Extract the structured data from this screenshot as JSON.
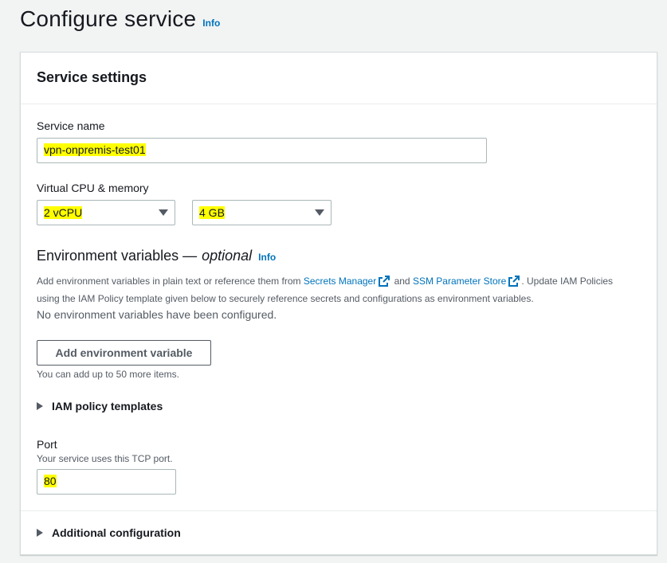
{
  "page": {
    "title": "Configure service",
    "info": "Info"
  },
  "panel": {
    "title": "Service settings"
  },
  "service_name": {
    "label": "Service name",
    "value": "vpn-onpremis-test01"
  },
  "compute": {
    "label": "Virtual CPU & memory",
    "cpu": "2 vCPU",
    "memory": "4 GB"
  },
  "env": {
    "title": "Environment variables —",
    "optional": "optional",
    "info": "Info",
    "desc_1": "Add environment variables in plain text or reference them from",
    "link_secrets": "Secrets Manager",
    "desc_and": "and",
    "link_ssm": "SSM Parameter Store",
    "desc_2": ". Update IAM Policies",
    "desc_3": "using the IAM Policy template given below to securely reference secrets and configurations as environment variables.",
    "empty": "No environment variables have been configured.",
    "add_button": "Add environment variable",
    "limit": "You can add up to 50 more items."
  },
  "iam": {
    "label": "IAM policy templates"
  },
  "port": {
    "label": "Port",
    "hint": "Your service uses this TCP port.",
    "value": "80"
  },
  "additional": {
    "label": "Additional configuration"
  },
  "colors": {
    "link": "#0073bb",
    "highlight": "#ffff00",
    "background": "#f2f3f3"
  }
}
